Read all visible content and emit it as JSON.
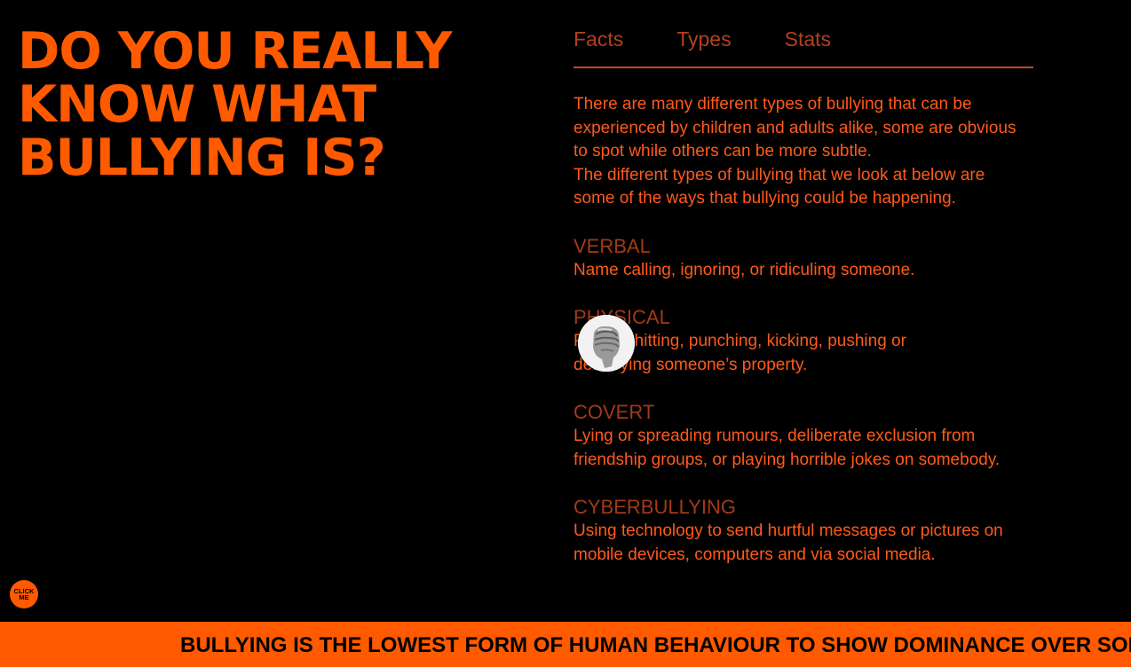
{
  "headline": {
    "lines": [
      "DO YOU REALLY",
      "KNOW WHAT",
      "BULLYING IS?"
    ]
  },
  "tabs": [
    {
      "label": "Facts"
    },
    {
      "label": "Types"
    },
    {
      "label": "Stats"
    }
  ],
  "intro": {
    "paragraph1": "There are many different types of bullying that can be experienced by children and adults alike, some are obvious to spot while others can be more subtle.",
    "paragraph2": "The different types of bullying that we look at below are some of the ways that bullying could be happening."
  },
  "types": [
    {
      "title": "VERBAL",
      "description": "Name calling, ignoring, or ridiculing someone."
    },
    {
      "title": "PHYSICAL",
      "description": "Poking, hitting, punching, kicking, pushing or destroying someone’s property."
    },
    {
      "title": "COVERT",
      "description": "Lying or spreading rumours, deliberate exclusion from friendship groups, or playing horrible jokes on somebody."
    },
    {
      "title": "CYBERBULLYING",
      "description": "Using technology to send hurtful messages or pictures on mobile devices, computers and via social media."
    }
  ],
  "click_button": {
    "label": "CLICK\nME"
  },
  "ticker": {
    "text": "BULLYING IS THE LOWEST FORM OF HUMAN BEHAVIOUR TO SHOW DOMINANCE OVER SOMEONE"
  },
  "cursor": {
    "icon": "fist-icon"
  },
  "colors": {
    "accent": "#ff5a00",
    "text": "#ff5a1a",
    "muted": "#b2401c",
    "background": "#000000"
  }
}
